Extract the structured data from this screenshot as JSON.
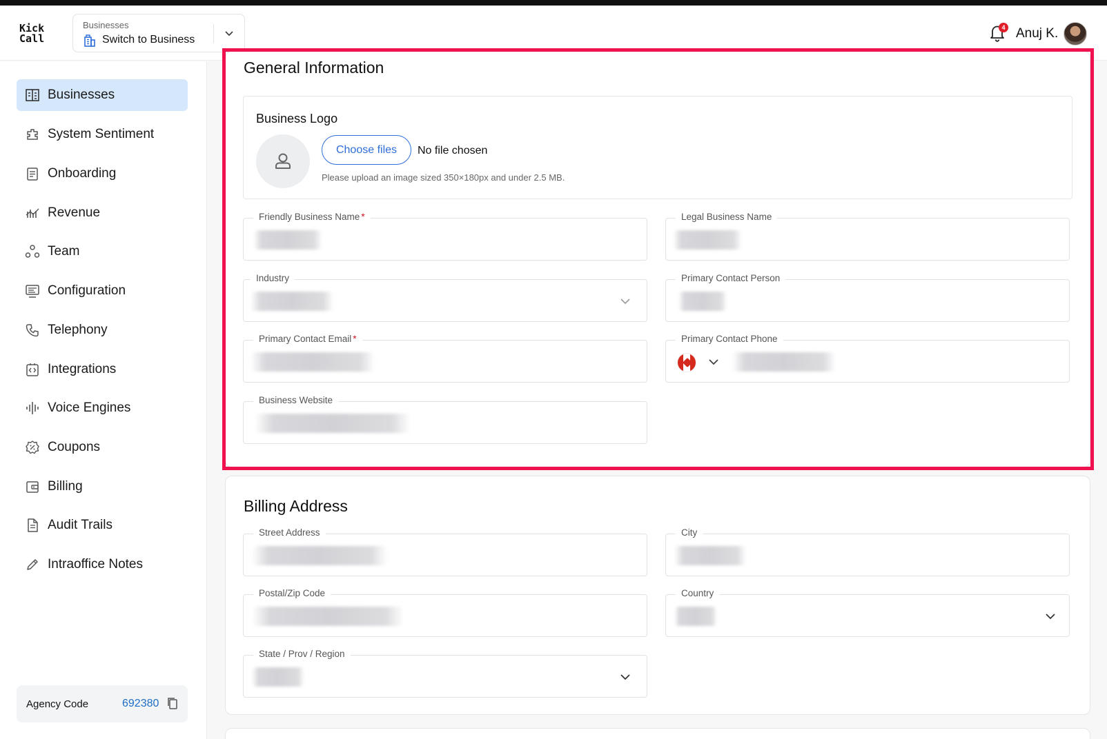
{
  "app": {
    "logo_line1": "Kick",
    "logo_line2": "Call"
  },
  "business_switcher": {
    "label": "Businesses",
    "value": "Switch to Business"
  },
  "user": {
    "name": "Anuj K.",
    "notification_count": "4"
  },
  "sidebar": {
    "items": [
      {
        "label": "Businesses",
        "icon": "building-icon",
        "active": true
      },
      {
        "label": "System Sentiment",
        "icon": "puzzle-icon"
      },
      {
        "label": "Onboarding",
        "icon": "document-icon"
      },
      {
        "label": "Revenue",
        "icon": "chart-icon"
      },
      {
        "label": "Team",
        "icon": "team-icon"
      },
      {
        "label": "Configuration",
        "icon": "monitor-settings-icon"
      },
      {
        "label": "Telephony",
        "icon": "phone-icon"
      },
      {
        "label": "Integrations",
        "icon": "code-icon"
      },
      {
        "label": "Voice Engines",
        "icon": "waveform-icon"
      },
      {
        "label": "Coupons",
        "icon": "coupon-icon"
      },
      {
        "label": "Billing",
        "icon": "wallet-icon"
      },
      {
        "label": "Audit Trails",
        "icon": "file-list-icon"
      },
      {
        "label": "Intraoffice Notes",
        "icon": "pencil-icon"
      }
    ],
    "agency": {
      "label": "Agency Code",
      "code": "692380"
    }
  },
  "general": {
    "title": "General Information",
    "logo": {
      "label": "Business Logo",
      "button": "Choose files",
      "status": "No file chosen",
      "hint": "Please upload an image sized 350×180px and under 2.5 MB."
    },
    "fields": {
      "friendly_name": "Friendly Business Name",
      "legal_name": "Legal Business Name",
      "industry": "Industry",
      "contact_person": "Primary Contact Person",
      "contact_email": "Primary Contact Email",
      "contact_phone": "Primary Contact Phone",
      "website": "Business Website"
    },
    "required_mark": "*"
  },
  "billing": {
    "title": "Billing Address",
    "fields": {
      "street": "Street Address",
      "city": "City",
      "postal": "Postal/Zip Code",
      "country": "Country",
      "state": "State / Prov / Region"
    }
  },
  "colors": {
    "accent": "#2e6ed8",
    "active_nav": "#d5e8fb",
    "highlight": "#f0124e",
    "required": "#d0101e"
  }
}
